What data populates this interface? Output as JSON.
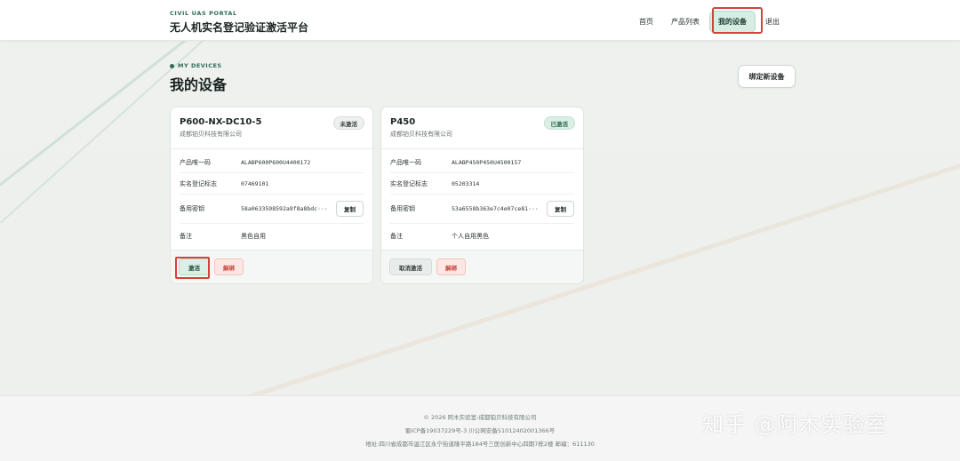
{
  "header": {
    "portal_label": "CIVIL UAS PORTAL",
    "title": "无人机实名登记验证激活平台",
    "nav": [
      "首页",
      "产品列表",
      "我的设备",
      "退出"
    ]
  },
  "section": {
    "kicker": "MY DEVICES",
    "title": "我的设备",
    "bind_button": "绑定新设备"
  },
  "fields": {
    "product_code": "产品唯一码",
    "registration": "实名登记标志",
    "backup_key": "备用密钥",
    "note": "备注",
    "copy": "复制"
  },
  "devices": [
    {
      "name": "P600-NX-DC10-5",
      "company": "成都铂贝科技有限公司",
      "status": "未激活",
      "product_code": "ALABP600P600U4400172",
      "registration": "07469101",
      "backup_key": "58a0633598592a9f8a8bdc···",
      "note": "黑色自用",
      "primary_action": "激活",
      "unbind": "解绑"
    },
    {
      "name": "P450",
      "company": "成都铂贝科技有限公司",
      "status": "已激活",
      "product_code": "ALABP450P450U4500157",
      "registration": "05203314",
      "backup_key": "53a6558b363e7c4e07ce81···",
      "note": "个人自用黑色",
      "primary_action": "取消激活",
      "unbind": "解绑"
    }
  ],
  "footer": {
    "copyright": "© 2026 阿木实验室-成都铂贝科技有限公司",
    "icp": "蜀ICP备19037229号-3  川公网安备51012402001366号",
    "address": "地址:四川省成都市温江区永宁街道隆平路184号三医创新中心四期7栋2楼  邮编：611130"
  },
  "watermark": "知乎 @阿木实验室",
  "colors": {
    "accent": "#2f6b5a",
    "highlight": "#d9403a",
    "danger": "#c2473b"
  }
}
